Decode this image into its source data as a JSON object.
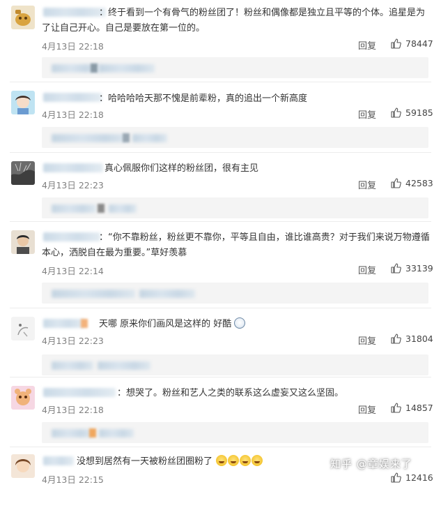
{
  "reply_label": "回复",
  "watermark": "知乎 @章娱来了",
  "comments": [
    {
      "text_line1": "：终于看到一个有骨气的粉丝团了！粉丝和偶像都是独立且平等的个体。追星是为",
      "text_line2": "了让自己开心。自己是要放在第一位的。",
      "date": "4月13日 22:18",
      "likes": "78447"
    },
    {
      "text_line1": "：哈哈哈哈天那不愧是前辈粉，真的追出一个新高度",
      "text_line2": "",
      "date": "4月13日 22:18",
      "likes": "59185"
    },
    {
      "text_line1": "真心佩服你们这样的粉丝团，很有主见",
      "text_line2": "",
      "date": "4月13日 22:23",
      "likes": "42583"
    },
    {
      "text_line1": "：“你不靠粉丝，粉丝更不靠你，平等且自由，谁比谁高贵？对于我们来说万物遵循",
      "text_line2": "本心，洒脱自在最为重要。”草好羡慕",
      "date": "4月13日 22:14",
      "likes": "33139"
    },
    {
      "text_line1": "天哪 原来你们画风是这样的 好酷",
      "text_line2": "",
      "date": "4月13日 22:23",
      "likes": "31804"
    },
    {
      "text_line1": "：想哭了。粉丝和艺人之类的联系这么虚妄又这么坚固。",
      "text_line2": "",
      "date": "4月13日 22:18",
      "likes": "14857"
    },
    {
      "text_line1": "没想到居然有一天被粉丝团圈粉了",
      "text_line2": "",
      "date": "4月13日 22:15",
      "likes": "12416"
    }
  ],
  "icons": {
    "like": "thumbs-up-icon",
    "emoji_cool": "cool-face-icon",
    "emoji_cry": "crying-face-icon"
  },
  "colors": {
    "date": "#808080",
    "subbar": "#f4f4f4"
  }
}
